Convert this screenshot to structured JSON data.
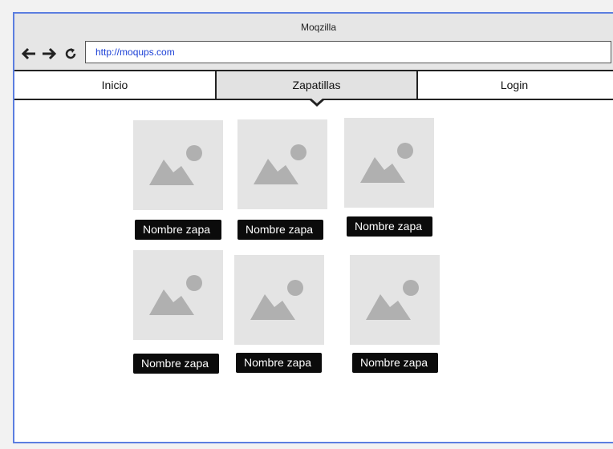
{
  "window": {
    "title": "Moqzilla"
  },
  "toolbar": {
    "url": "http://moqups.com",
    "icons": [
      "back-arrow-icon",
      "forward-arrow-icon",
      "reload-icon"
    ]
  },
  "tabs": [
    {
      "label": "Inicio"
    },
    {
      "label": "Zapatillas",
      "selected": true
    },
    {
      "label": "Login"
    }
  ],
  "products": [
    {
      "name": "Nombre zapa"
    },
    {
      "name": "Nombre zapa"
    },
    {
      "name": "Nombre zapa"
    },
    {
      "name": "Nombre zapa"
    },
    {
      "name": "Nombre zapa"
    },
    {
      "name": "Nombre zapa"
    }
  ],
  "colors": {
    "window_border": "#5b7ee0",
    "url_text": "#1a3fd6",
    "placeholder": "#e4e4e4",
    "placeholder_icon": "#b0b0b0",
    "label_bg": "#0b0b0b"
  }
}
